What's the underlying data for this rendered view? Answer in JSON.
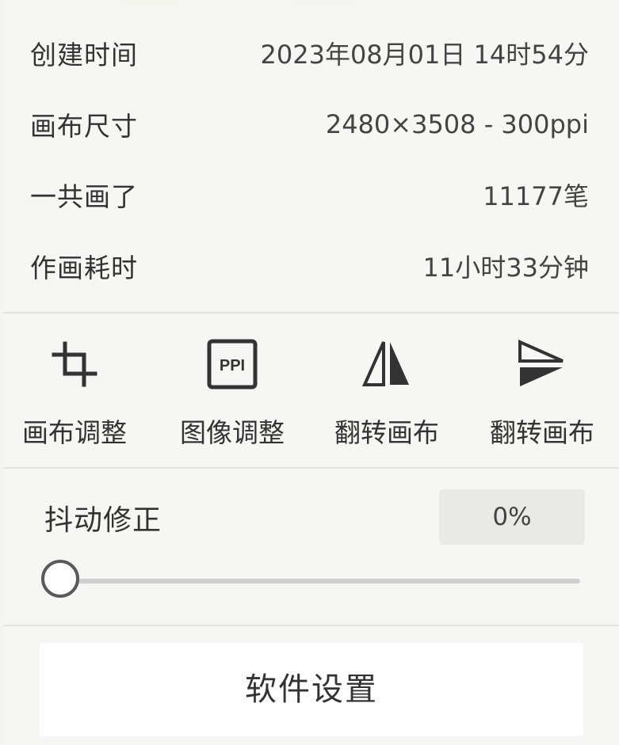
{
  "info": [
    {
      "label": "创建时间",
      "value": "2023年08月01日 14时54分"
    },
    {
      "label": "画布尺寸",
      "value": "2480×3508 - 300ppi"
    },
    {
      "label": "一共画了",
      "value": "11177笔"
    },
    {
      "label": "作画耗时",
      "value": "11小时33分钟"
    }
  ],
  "tools": [
    {
      "label": "画布调整",
      "icon": "crop-icon"
    },
    {
      "label": "图像调整",
      "icon": "ppi-icon",
      "icon_text": "PPI"
    },
    {
      "label": "翻转画布",
      "icon": "flip-horizontal-icon"
    },
    {
      "label": "翻转画布",
      "icon": "flip-vertical-icon"
    }
  ],
  "stabilizer": {
    "label": "抖动修正",
    "value_text": "0%",
    "value": 0
  },
  "settings_button": "软件设置",
  "colors": {
    "panel_bg": "#f6f6f4",
    "text": "#333333",
    "value_box": "#e9e9e7",
    "slider_track": "#cfcfcf",
    "knob_border": "#5a5a5a"
  }
}
